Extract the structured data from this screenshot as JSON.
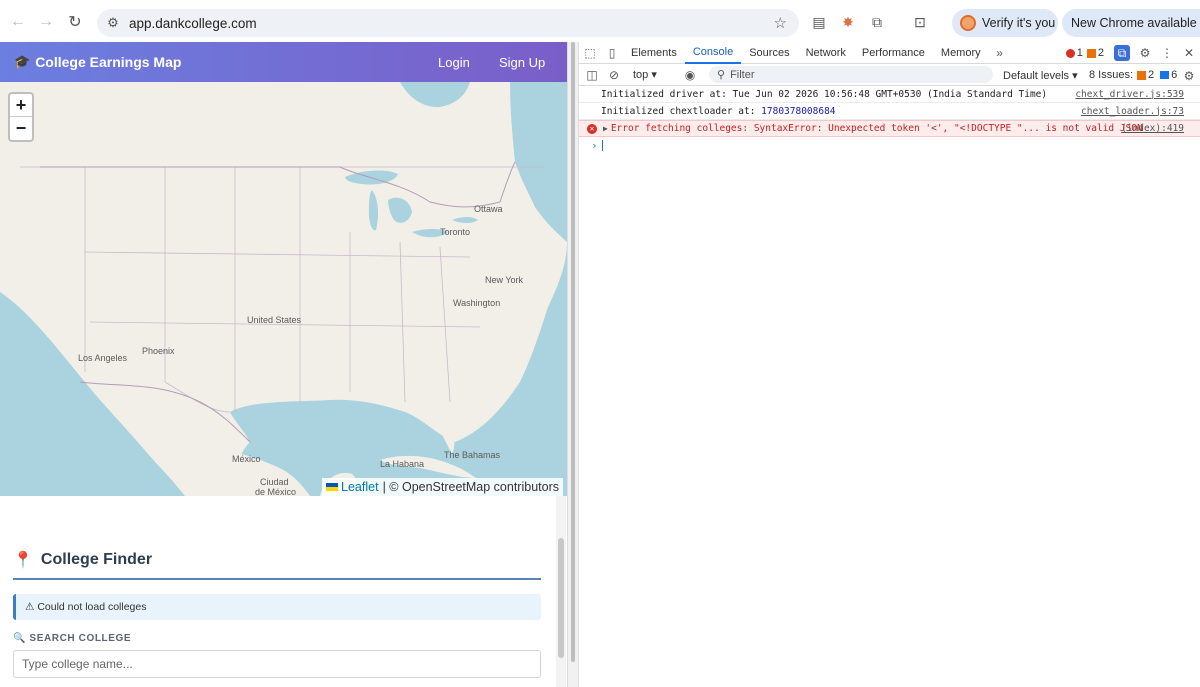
{
  "browser": {
    "url": "app.dankcollege.com",
    "verify_label": "Verify it's you",
    "update_label": "New Chrome available"
  },
  "app": {
    "title": "College Earnings Map",
    "login_label": "Login",
    "signup_label": "Sign Up"
  },
  "map": {
    "zoom_in": "+",
    "zoom_out": "−",
    "attribution_leaflet": "Leaflet",
    "attribution_rest": "| © OpenStreetMap contributors",
    "labels": [
      "Ottawa",
      "Toronto",
      "New York",
      "Washington",
      "United States",
      "Los Angeles",
      "Phoenix",
      "México",
      "La Habana",
      "The Bahamas",
      "Ciudad",
      "de México"
    ]
  },
  "finder": {
    "title": "College Finder",
    "alert": "⚠ Could not load colleges",
    "search_label": "🔍 SEARCH COLLEGE",
    "search_placeholder": "Type college name..."
  },
  "devtools": {
    "tabs": [
      "Elements",
      "Console",
      "Sources",
      "Network",
      "Performance",
      "Memory"
    ],
    "error_count": "1",
    "warning_count": "2",
    "context": "top",
    "filter_placeholder": "Filter",
    "levels": "Default levels",
    "issues_label": "8 Issues:",
    "issues_warn": "2",
    "issues_info": "6",
    "logs": [
      {
        "prefix": "Initialized driver at: Tue Jun 02 2026 10:56:48 GMT+0530 (India Standard Time)",
        "num": "",
        "source": "chext_driver.js:539"
      },
      {
        "prefix": "Initialized chextloader at: ",
        "num": "1780378008684",
        "source": "chext_loader.js:73"
      }
    ],
    "error": {
      "message": "Error fetching colleges: SyntaxError: Unexpected token '<', \"<!DOCTYPE \"... is not valid JSON",
      "source": "(index):419"
    }
  }
}
